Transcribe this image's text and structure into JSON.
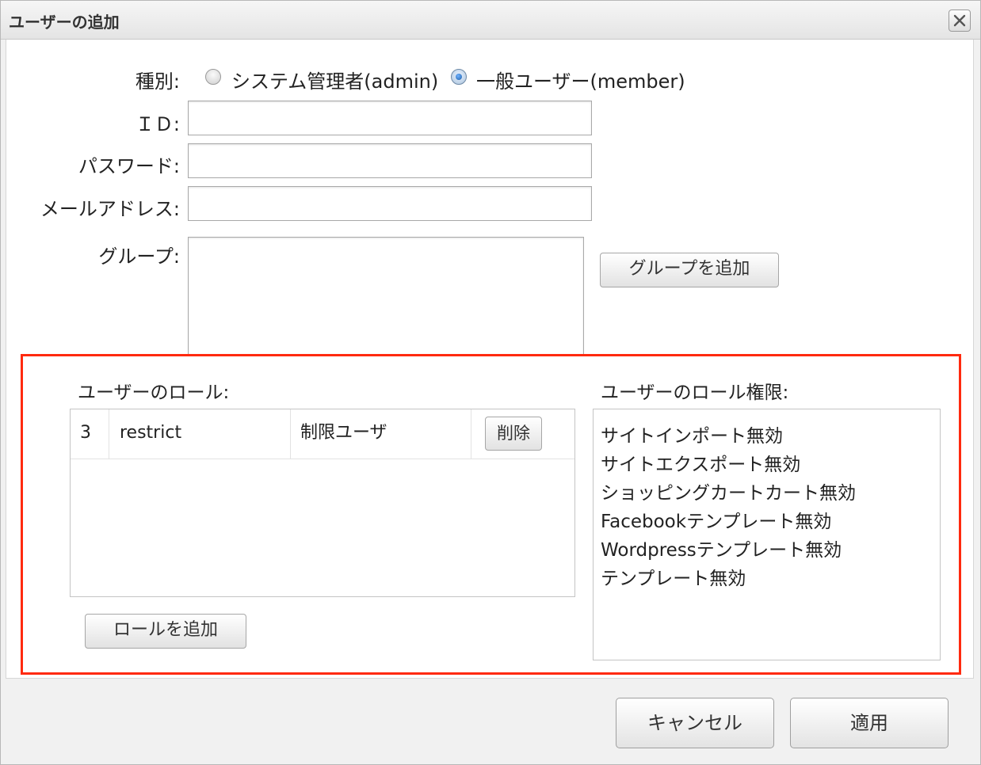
{
  "dialog": {
    "title": "ユーザーの追加",
    "close_icon": "close-icon"
  },
  "form": {
    "type_label": "種別:",
    "type_options": [
      {
        "label": "システム管理者(admin)",
        "checked": false
      },
      {
        "label": "一般ユーザー(member)",
        "checked": true
      }
    ],
    "id_label": "ＩＤ:",
    "id_value": "",
    "password_label": "パスワード:",
    "password_value": "",
    "email_label": "メールアドレス:",
    "email_value": "",
    "group_label": "グループ:",
    "add_group_button": "グループを追加"
  },
  "roles": {
    "label": "ユーザーのロール:",
    "rows": [
      {
        "id": "3",
        "name": "restrict",
        "display": "制限ユーザ",
        "delete_label": "削除"
      }
    ],
    "add_role_button": "ロールを追加"
  },
  "permissions": {
    "label": "ユーザーのロール権限:",
    "items": [
      "サイトインポート無効",
      "サイトエクスポート無効",
      "ショッピングカートカート無効",
      "Facebookテンプレート無効",
      "Wordpressテンプレート無効",
      "テンプレート無効"
    ]
  },
  "footer": {
    "cancel": "キャンセル",
    "apply": "適用"
  },
  "colors": {
    "highlight_border": "#ff2a0f"
  }
}
